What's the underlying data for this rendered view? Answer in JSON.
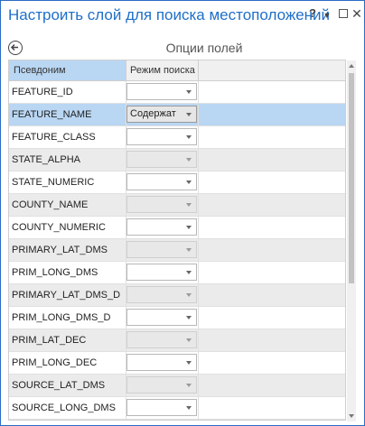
{
  "window": {
    "title": "Настроить слой для поиска местоположений",
    "help": "?",
    "pin": "▼",
    "close": "✕"
  },
  "panel": {
    "subtitle": "Опции полей"
  },
  "table": {
    "headers": {
      "alias": "Псевдоним",
      "search_mode": "Режим поиска"
    },
    "rows": [
      {
        "name": "FEATURE_ID",
        "mode": ""
      },
      {
        "name": "FEATURE_NAME",
        "mode": "Содержат"
      },
      {
        "name": "FEATURE_CLASS",
        "mode": ""
      },
      {
        "name": "STATE_ALPHA",
        "mode": ""
      },
      {
        "name": "STATE_NUMERIC",
        "mode": ""
      },
      {
        "name": "COUNTY_NAME",
        "mode": ""
      },
      {
        "name": "COUNTY_NUMERIC",
        "mode": ""
      },
      {
        "name": "PRIMARY_LAT_DMS",
        "mode": ""
      },
      {
        "name": "PRIM_LONG_DMS",
        "mode": ""
      },
      {
        "name": "PRIMARY_LAT_DMS_D",
        "mode": ""
      },
      {
        "name": "PRIM_LONG_DMS_D",
        "mode": ""
      },
      {
        "name": "PRIM_LAT_DEC",
        "mode": ""
      },
      {
        "name": "PRIM_LONG_DEC",
        "mode": ""
      },
      {
        "name": "SOURCE_LAT_DMS",
        "mode": ""
      },
      {
        "name": "SOURCE_LONG_DMS",
        "mode": ""
      },
      {
        "name": "",
        "mode": ""
      }
    ]
  },
  "colors": {
    "accent": "#1e6fc8",
    "selected_row": "#b9d6f3",
    "alt_row": "#ebebeb"
  }
}
